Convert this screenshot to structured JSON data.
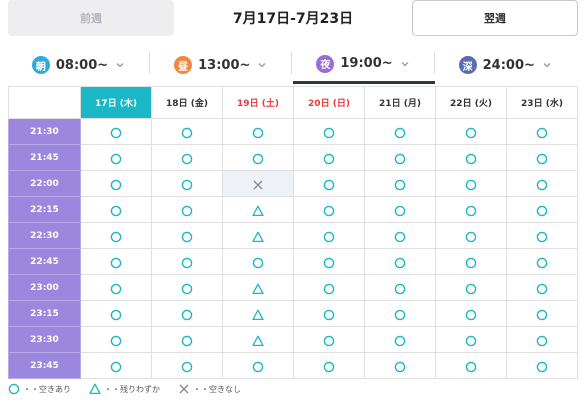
{
  "week_nav": {
    "prev_label": "前週",
    "range": "7月17日-7月23日",
    "next_label": "翌週"
  },
  "time_tabs": [
    {
      "icon_char": "朝",
      "time": "08:00~",
      "color": "#2eaadc",
      "active": false
    },
    {
      "icon_char": "昼",
      "time": "13:00~",
      "color": "#f0883e",
      "active": false
    },
    {
      "icon_char": "夜",
      "time": "19:00~",
      "color": "#9b6ddb",
      "active": true
    },
    {
      "icon_char": "深",
      "time": "24:00~",
      "color": "#5b6bb5",
      "active": false
    }
  ],
  "days": [
    {
      "label": "17日 (木)",
      "type": "today"
    },
    {
      "label": "18日 (金)",
      "type": "weekday"
    },
    {
      "label": "19日 (土)",
      "type": "sat"
    },
    {
      "label": "20日 (日)",
      "type": "sun"
    },
    {
      "label": "21日 (月)",
      "type": "weekday"
    },
    {
      "label": "22日 (火)",
      "type": "weekday"
    },
    {
      "label": "23日 (水)",
      "type": "weekday"
    }
  ],
  "slots": [
    {
      "time": "21:30",
      "hour": false,
      "status": [
        "o",
        "o",
        "o",
        "o",
        "o",
        "o",
        "o"
      ]
    },
    {
      "time": "21:45",
      "hour": false,
      "status": [
        "o",
        "o",
        "o",
        "o",
        "o",
        "o",
        "o"
      ]
    },
    {
      "time": "22:00",
      "hour": true,
      "status": [
        "o",
        "o",
        "x",
        "o",
        "o",
        "o",
        "o"
      ]
    },
    {
      "time": "22:15",
      "hour": false,
      "status": [
        "o",
        "o",
        "t",
        "o",
        "o",
        "o",
        "o"
      ]
    },
    {
      "time": "22:30",
      "hour": false,
      "status": [
        "o",
        "o",
        "t",
        "o",
        "o",
        "o",
        "o"
      ]
    },
    {
      "time": "22:45",
      "hour": false,
      "status": [
        "o",
        "o",
        "o",
        "o",
        "o",
        "o",
        "o"
      ]
    },
    {
      "time": "23:00",
      "hour": true,
      "status": [
        "o",
        "o",
        "t",
        "o",
        "o",
        "o",
        "o"
      ]
    },
    {
      "time": "23:15",
      "hour": false,
      "status": [
        "o",
        "o",
        "t",
        "o",
        "o",
        "o",
        "o"
      ]
    },
    {
      "time": "23:30",
      "hour": false,
      "status": [
        "o",
        "o",
        "t",
        "o",
        "o",
        "o",
        "o"
      ]
    },
    {
      "time": "23:45",
      "hour": false,
      "status": [
        "o",
        "o",
        "o",
        "o",
        "o",
        "o",
        "o"
      ]
    }
  ],
  "legend": [
    {
      "symbol": "o",
      "label": "・・空きあり"
    },
    {
      "symbol": "t",
      "label": "・・残りわずか"
    },
    {
      "symbol": "x",
      "label": "・・空きなし"
    }
  ],
  "colors": {
    "available": "#1ab8c6",
    "unavailable": "#888888",
    "today": "#1ab8c6",
    "time_column": "#9b87dd",
    "weekend": "#e53b3b"
  },
  "icons": {
    "available": "circle-icon",
    "few_left": "triangle-icon",
    "full": "cross-icon",
    "dropdown": "chevron-down-icon"
  }
}
